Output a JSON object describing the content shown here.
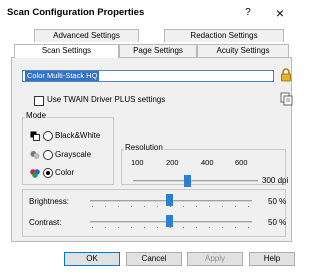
{
  "window": {
    "title": "Scan Configuration Properties",
    "help_glyph": "?",
    "close_glyph": "×"
  },
  "tabs": {
    "row1": [
      "Advanced Settings",
      "Redaction Settings"
    ],
    "row2": [
      "Scan Settings",
      "Page Settings",
      "Acuity Settings"
    ],
    "active": "Scan Settings"
  },
  "config": {
    "selected": "Color Multi-Stack HQ"
  },
  "twain": {
    "label": "Use TWAIN Driver PLUS settings",
    "checked": false
  },
  "mode": {
    "label": "Mode",
    "options": [
      "Black&White",
      "Grayscale",
      "Color"
    ],
    "selected": "Color"
  },
  "resolution": {
    "label": "Resolution",
    "ticks": [
      "100",
      "200",
      "400",
      "600"
    ],
    "value_label": "300 dpi",
    "value": 300
  },
  "brightness": {
    "label": "Brightness:",
    "value_label": "50 %",
    "value": 50
  },
  "contrast": {
    "label": "Contrast:",
    "value_label": "50 %",
    "value": 50
  },
  "buttons": {
    "ok": "OK",
    "cancel": "Cancel",
    "apply": "Apply",
    "help": "Help"
  },
  "colors": {
    "accent": "#2d7fd0",
    "selection": "#3272c8"
  }
}
